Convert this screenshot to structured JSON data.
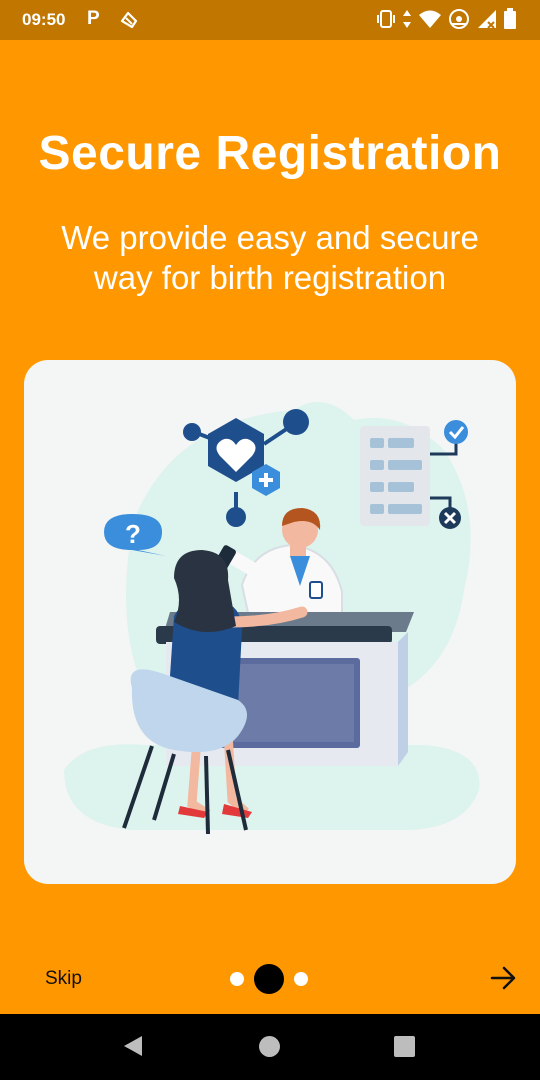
{
  "status_bar": {
    "time": "09:50",
    "left_icons": [
      "parking-p-icon",
      "hand-wave-icon"
    ],
    "right_icons": [
      "vibrate-icon",
      "data-arrows-icon",
      "wifi-icon",
      "hotspot-icon",
      "signal-icon",
      "battery-icon"
    ]
  },
  "onboarding": {
    "title": "Secure Registration",
    "subtitle": "We provide easy and secure way for birth registration",
    "illustration_icon": "doctor-registration-illustration-icon"
  },
  "bottom_nav": {
    "skip_label": "Skip",
    "page_indicator": {
      "total": 3,
      "current": 2
    },
    "next_icon": "arrow-right-icon"
  },
  "system_nav": {
    "back_icon": "triangle-back-icon",
    "home_icon": "circle-home-icon",
    "recents_icon": "square-recents-icon"
  },
  "colors": {
    "background": "#FF9800",
    "status_bar": "#C17600",
    "card": "#F4F5F5",
    "accent_blue": "#1E4F8C",
    "text_light": "#FFFFFF"
  }
}
